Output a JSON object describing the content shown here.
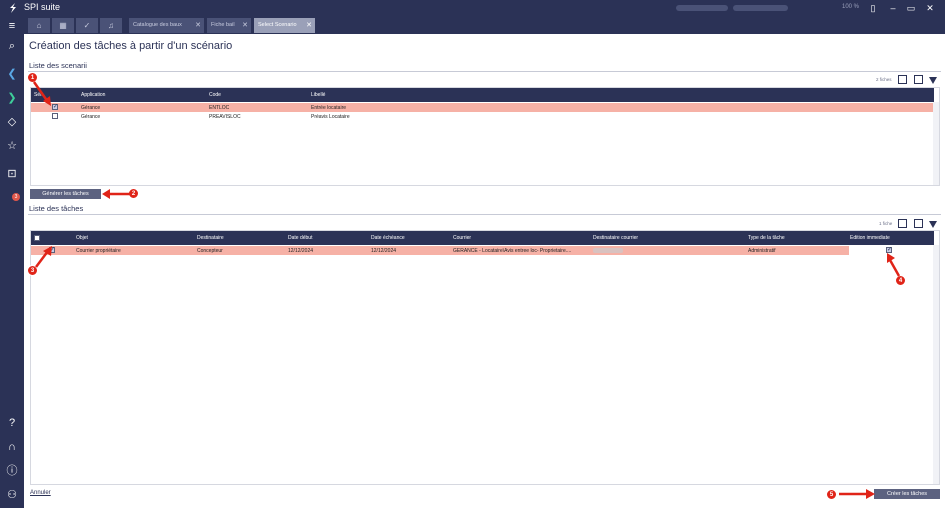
{
  "app": {
    "title": "SPI suite",
    "zoom": "100 %"
  },
  "tabs": [
    {
      "label": "Catalogue des baux"
    },
    {
      "label": "Fiche bail"
    },
    {
      "label": "Select Scenario"
    }
  ],
  "page": {
    "title": "Création des tâches à partir d'un scénario"
  },
  "scenarios": {
    "title": "Liste des scenarii",
    "count": "2 fiches",
    "headers": [
      "Sél.",
      "Application",
      "Code",
      "Libellé"
    ],
    "rows": [
      {
        "application": "Gérance",
        "code": "ENTLOC",
        "libelle": "Entrée locataire",
        "selected": true
      },
      {
        "application": "Gérance",
        "code": "PREAVISLOC",
        "libelle": "Préavis Locataire",
        "selected": false
      }
    ],
    "generate_button": "Générer les tâches"
  },
  "tasks": {
    "title": "Liste des tâches",
    "count": "1 fiche",
    "headers": [
      "Objet",
      "Destinataire",
      "Date début",
      "Date échéance",
      "Courrier",
      "Destinataire courrier",
      "Type de la tâche",
      "Edition immediate"
    ],
    "rows": [
      {
        "objet": "Courrier propriétaire",
        "destinataire": "Concepteur",
        "date_debut": "12/12/2024",
        "date_echeance": "12/12/2024",
        "courrier": "GERANCE - Locataire\\Avis entree loc- Proprietaire....",
        "type": "Administratif",
        "checked": true,
        "edition_immediate": true
      }
    ]
  },
  "footer": {
    "cancel_link": "Annuler",
    "create_button": "Créer les tâches"
  },
  "annotations": [
    "1",
    "2",
    "3",
    "4",
    "5"
  ],
  "colors": {
    "brand": "#2b3256",
    "selected_row": "#f6b1a6",
    "annotation": "#e02418"
  }
}
